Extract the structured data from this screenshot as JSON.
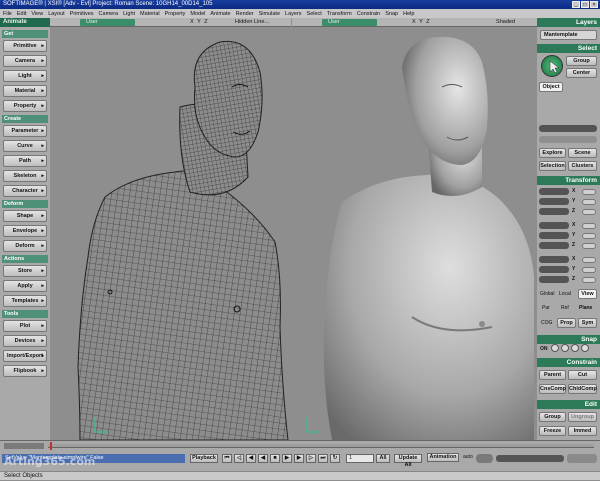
{
  "window": {
    "title": "SOFTIMAGE® | XSI® [Adv - Evl] Project: Roman      Scene: 10GH14_00D14_105",
    "min": "_",
    "max": "□",
    "close": "×"
  },
  "menu": [
    "File",
    "Edit",
    "View",
    "Layout",
    "Primitives",
    "Camera",
    "Light",
    "Material",
    "Property",
    "Model",
    "Animate",
    "Render",
    "Simulate",
    "Layers",
    "Select",
    "Transform",
    "Constrain",
    "Snap",
    "Help"
  ],
  "left_panel": {
    "title": "Animate",
    "sections": [
      {
        "name": "Get",
        "buttons": [
          "Primitive",
          "Camera",
          "Light",
          "Material",
          "Property"
        ]
      },
      {
        "name": "Create",
        "buttons": [
          "Parameter",
          "Curve",
          "Path",
          "Skeleton",
          "Character"
        ]
      },
      {
        "name": "Deform",
        "buttons": [
          "Shape",
          "Envelope",
          "Deform"
        ]
      },
      {
        "name": "Actions",
        "buttons": [
          "Store",
          "Apply",
          "Templates"
        ]
      },
      {
        "name": "Tools",
        "buttons": [
          "Plot",
          "Devices",
          "Import/Export",
          "Flipbook"
        ]
      }
    ]
  },
  "viewports": {
    "left": {
      "camera": "User",
      "axes": "X Y Z",
      "mode": "Hidden Line..."
    },
    "right": {
      "camera": "User",
      "axes": "X Y Z",
      "mode": "Shaded"
    }
  },
  "right_panel": {
    "layers_title": "Layers",
    "layers_value": "Mantemplate",
    "select_title": "Select",
    "group": "Group",
    "center": "Center",
    "object": "Object",
    "explore": "Explore",
    "scene": "Scene",
    "selection": "Selection",
    "clusters": "Clusters",
    "transform_title": "Transform",
    "axis_labels": [
      "X",
      "Y",
      "Z"
    ],
    "global": "Global",
    "local": "Local",
    "view": "View",
    "par": "Par",
    "ref": "Ref",
    "plane": "Plane",
    "cog": "COG",
    "prop": "Prop",
    "sym": "Sym",
    "snap_title": "Snap",
    "snap_on": "ON",
    "constrain_title": "Constrain",
    "parent": "Parent",
    "cut": "Cut",
    "cnscomp": "CnsComp",
    "chldcomp": "ChldComp",
    "edit_title": "Edit",
    "group_btn": "Group",
    "ungroup": "Ungroup",
    "freeze": "Freeze",
    "immed": "Immed"
  },
  "bottom": {
    "command": "SetValue \"Mantemplate.simplwire\" False",
    "playback": "Playback",
    "frame": "1",
    "all": "All",
    "update_all": "Update All",
    "animation": "Animation",
    "auto": "auto"
  },
  "watermark": "Arting365.com",
  "status": "Select Objects"
}
